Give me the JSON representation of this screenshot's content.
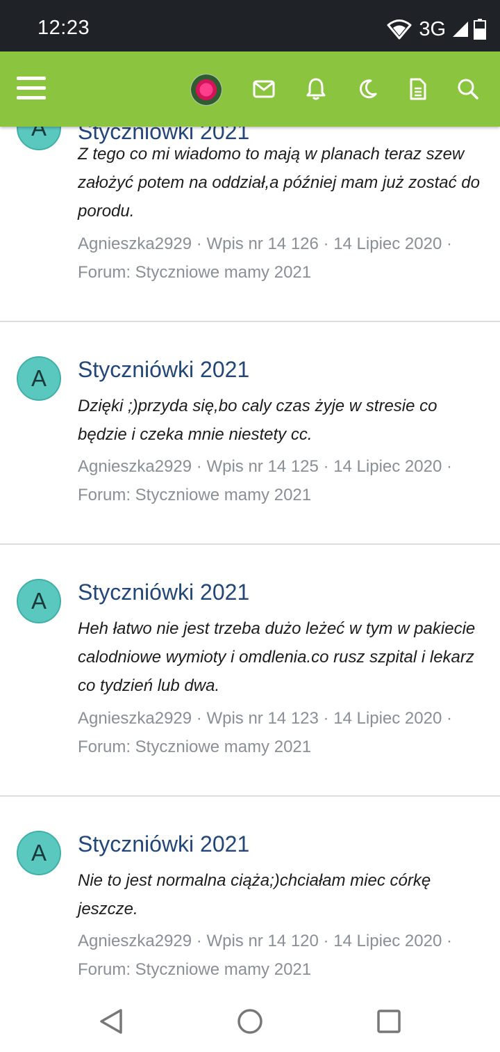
{
  "status_bar": {
    "time": "12:23",
    "network": "3G",
    "icons": [
      "wifi-icon",
      "signal-icon",
      "battery-icon"
    ]
  },
  "header": {
    "icons": [
      "menu-icon",
      "user-avatar",
      "mail-icon",
      "bell-icon",
      "moon-icon",
      "document-icon",
      "search-icon"
    ],
    "accent_color": "#8bc53f"
  },
  "posts": [
    {
      "avatar_letter": "A",
      "title": "Styczniówki 2021",
      "text": "Z tego co mi wiadomo to mają w planach teraz szew założyć potem na oddział,a później mam już zostać do porodu.",
      "meta_line1": "Agnieszka2929 · Wpis nr 14 126 · 14 Lipiec 2020 ·",
      "meta_line2": "Forum: Styczniowe mamy 2021"
    },
    {
      "avatar_letter": "A",
      "title": "Styczniówki 2021",
      "text": "Dzięki ;)przyda się,bo caly czas żyje w stresie co będzie i czeka mnie niestety cc.",
      "meta_line1": "Agnieszka2929 · Wpis nr 14 125 · 14 Lipiec 2020 ·",
      "meta_line2": "Forum: Styczniowe mamy 2021"
    },
    {
      "avatar_letter": "A",
      "title": "Styczniówki 2021",
      "text": "Heh łatwo nie jest trzeba dużo leżeć w tym w pakiecie calodniowe wymioty i omdlenia.co rusz szpital i lekarz co tydzień lub dwa.",
      "meta_line1": "Agnieszka2929 · Wpis nr 14 123 · 14 Lipiec 2020 ·",
      "meta_line2": "Forum: Styczniowe mamy 2021"
    },
    {
      "avatar_letter": "A",
      "title": "Styczniówki 2021",
      "text": "Nie to jest normalna ciąża;)chciałam miec córkę jeszcze.",
      "meta_line1": "Agnieszka2929 · Wpis nr 14 120 · 14 Lipiec 2020 ·",
      "meta_line2": "Forum: Styczniowe mamy 2021"
    }
  ],
  "nav_bar": {
    "icons": [
      "back-icon",
      "home-icon",
      "recents-icon"
    ]
  }
}
